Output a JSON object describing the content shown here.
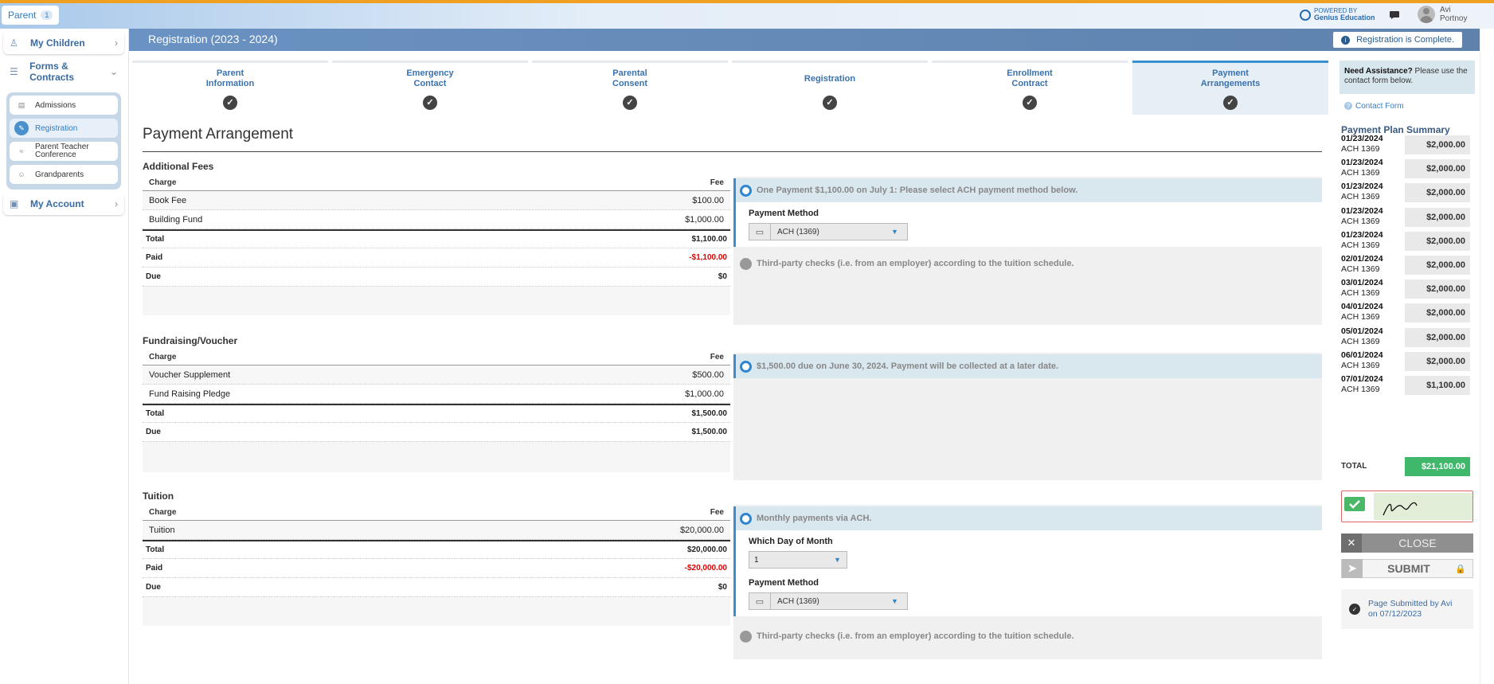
{
  "topbar": {
    "role_label": "Parent",
    "role_count": "1",
    "powered_by": "POWERED BY",
    "brand": "Genius Education",
    "user_first": "Avi",
    "user_last": "Portnoy"
  },
  "sidebar": {
    "my_children": "My Children",
    "forms_contracts": "Forms & Contracts",
    "sub_items": [
      "Admissions",
      "Registration",
      "Parent Teacher Conference",
      "Grandparents"
    ],
    "my_account": "My Account"
  },
  "header": {
    "title": "Registration (2023 - 2024)",
    "status": "Registration is Complete."
  },
  "steps": [
    {
      "line1": "Parent",
      "line2": "Information"
    },
    {
      "line1": "Emergency",
      "line2": "Contact"
    },
    {
      "line1": "Parental",
      "line2": "Consent"
    },
    {
      "line1": "Registration",
      "line2": ""
    },
    {
      "line1": "Enrollment",
      "line2": "Contract"
    },
    {
      "line1": "Payment",
      "line2": "Arrangements"
    }
  ],
  "page_title": "Payment Arrangement",
  "columns": {
    "charge": "Charge",
    "fee": "Fee"
  },
  "sections": [
    {
      "title": "Additional Fees",
      "rows": [
        {
          "charge": "Book Fee",
          "fee": "$100.00"
        },
        {
          "charge": "Building Fund",
          "fee": "$1,000.00"
        }
      ],
      "total_label": "Total",
      "total": "$1,100.00",
      "paid_label": "Paid",
      "paid": "-$1,100.00",
      "due_label": "Due",
      "due": "$0",
      "option_selected": "One Payment $1,100.00 on July 1: Please select ACH payment method below.",
      "payment_method_label": "Payment Method",
      "payment_method": "ACH (1369)",
      "option_other": "Third-party checks (i.e. from an employer) according to the tuition schedule."
    },
    {
      "title": "Fundraising/Voucher",
      "rows": [
        {
          "charge": "Voucher Supplement",
          "fee": "$500.00"
        },
        {
          "charge": "Fund Raising Pledge",
          "fee": "$1,000.00"
        }
      ],
      "total_label": "Total",
      "total": "$1,500.00",
      "due_label": "Due",
      "due": "$1,500.00",
      "option_selected": "$1,500.00 due on June 30, 2024. Payment will be collected at a later date."
    },
    {
      "title": "Tuition",
      "rows": [
        {
          "charge": "Tuition",
          "fee": "$20,000.00"
        }
      ],
      "total_label": "Total",
      "total": "$20,000.00",
      "paid_label": "Paid",
      "paid": "-$20,000.00",
      "due_label": "Due",
      "due": "$0",
      "option_selected": "Monthly payments via ACH.",
      "day_label": "Which Day of Month",
      "day_value": "1",
      "payment_method_label": "Payment Method",
      "payment_method": "ACH (1369)",
      "option_other": "Third-party checks (i.e. from an employer) according to the tuition schedule."
    }
  ],
  "assist": {
    "bold": "Need Assistance?",
    "text": " Please use the contact form below.",
    "link": "Contact Form"
  },
  "plan": {
    "title": "Payment Plan Summary",
    "rows": [
      {
        "date": "01/23/2024",
        "method": "ACH 1369",
        "amount": "$2,000.00"
      },
      {
        "date": "01/23/2024",
        "method": "ACH 1369",
        "amount": "$2,000.00"
      },
      {
        "date": "01/23/2024",
        "method": "ACH 1369",
        "amount": "$2,000.00"
      },
      {
        "date": "01/23/2024",
        "method": "ACH 1369",
        "amount": "$2,000.00"
      },
      {
        "date": "01/23/2024",
        "method": "ACH 1369",
        "amount": "$2,000.00"
      },
      {
        "date": "02/01/2024",
        "method": "ACH 1369",
        "amount": "$2,000.00"
      },
      {
        "date": "03/01/2024",
        "method": "ACH 1369",
        "amount": "$2,000.00"
      },
      {
        "date": "04/01/2024",
        "method": "ACH 1369",
        "amount": "$2,000.00"
      },
      {
        "date": "05/01/2024",
        "method": "ACH 1369",
        "amount": "$2,000.00"
      },
      {
        "date": "06/01/2024",
        "method": "ACH 1369",
        "amount": "$2,000.00"
      },
      {
        "date": "07/01/2024",
        "method": "ACH 1369",
        "amount": "$1,100.00"
      }
    ],
    "total_label": "TOTAL",
    "total": "$21,100.00"
  },
  "actions": {
    "close": "CLOSE",
    "submit": "SUBMIT",
    "submitted": "Page Submitted by Avi on 07/12/2023"
  },
  "colors": {
    "accent": "#3a90d0",
    "header": "#6a92c2",
    "total_green": "#3fb86b",
    "negative": "#dd0000"
  }
}
